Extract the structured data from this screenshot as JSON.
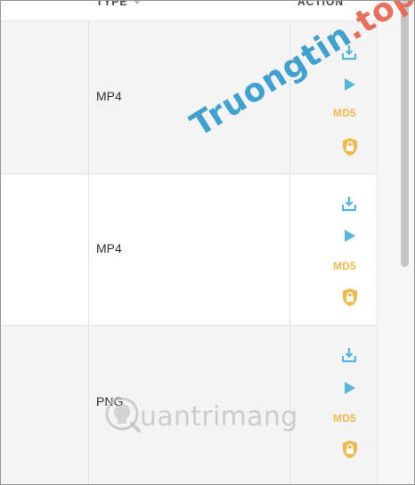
{
  "table": {
    "headers": {
      "type": "TYPE",
      "action": "ACTION"
    },
    "rows": [
      {
        "type": "MP4",
        "actions": {
          "download_icon": "download-icon",
          "play_icon": "play-icon",
          "md5_label": "MD5",
          "lock_icon": "lock-icon"
        }
      },
      {
        "type": "MP4",
        "actions": {
          "download_icon": "download-icon",
          "play_icon": "play-icon",
          "md5_label": "MD5",
          "lock_icon": "lock-icon"
        }
      },
      {
        "type": "PNG",
        "actions": {
          "download_icon": "download-icon",
          "play_icon": "play-icon",
          "md5_label": "MD5",
          "lock_icon": "lock-icon"
        }
      }
    ]
  },
  "watermarks": {
    "top_main": "Truongtin",
    "top_suffix": ".top",
    "bottom": "uantrimang"
  },
  "colors": {
    "icon_blue": "#58b7d9",
    "md5_orange": "#f2b94a",
    "lock_orange": "#f2b94a",
    "row_alt": "#f4f4f4",
    "watermark_blue": "#2795cc",
    "watermark_red": "#e9604a"
  }
}
